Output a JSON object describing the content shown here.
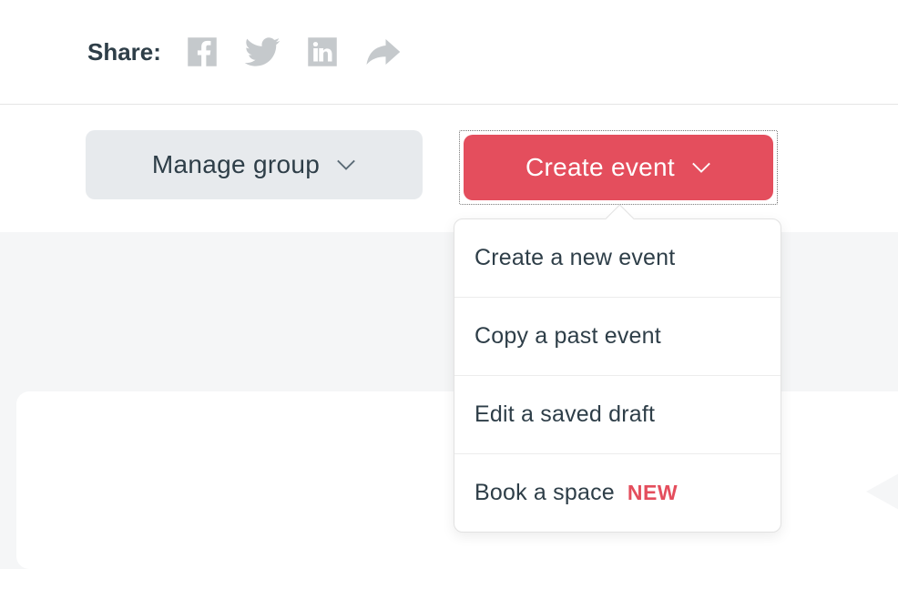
{
  "share": {
    "label": "Share:"
  },
  "buttons": {
    "manage_label": "Manage group",
    "create_label": "Create event"
  },
  "dropdown": {
    "items": [
      {
        "label": "Create a new event",
        "badge": ""
      },
      {
        "label": "Copy a past event",
        "badge": ""
      },
      {
        "label": "Edit a saved draft",
        "badge": ""
      },
      {
        "label": "Book a space",
        "badge": "NEW"
      }
    ]
  }
}
